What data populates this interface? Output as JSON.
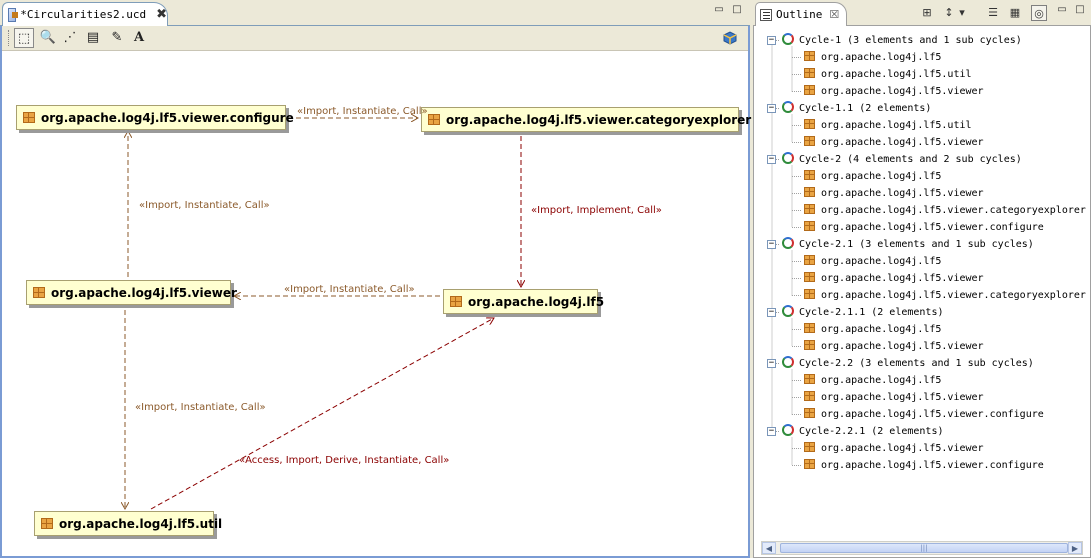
{
  "editor": {
    "tab_title": "*Circularities2.ucd",
    "tab_close": "✖",
    "minimize": "▭",
    "maximize": "□",
    "toolbar": {
      "select": "⬚",
      "zoom": "🔍",
      "connection": "⋰",
      "note": "▤",
      "pin": "✎",
      "text": "A"
    },
    "nodes": {
      "configure": "org.apache.log4j.lf5.viewer.configure",
      "categoryexplorer": "org.apache.log4j.lf5.viewer.categoryexplorer",
      "viewer": "org.apache.log4j.lf5.viewer",
      "lf5": "org.apache.log4j.lf5",
      "util": "org.apache.log4j.lf5.util"
    },
    "edges": {
      "configure_to_categoryexplorer": "«Import, Instantiate, Call»",
      "viewer_to_configure": "«Import, Instantiate, Call»",
      "categoryexplorer_to_lf5": "«Import, Implement, Call»",
      "lf5_to_viewer": "«Import, Instantiate, Call»",
      "viewer_to_util": "«Import, Instantiate, Call»",
      "util_to_lf5": "«Access, Import, Derive, Instantiate, Call»"
    },
    "colors": {
      "edge_brown": "#8b5a2b",
      "edge_red": "#8b0000"
    }
  },
  "outline": {
    "tab_title": "Outline",
    "tab_close": "☒",
    "minimize": "▭",
    "maximize": "□",
    "toolbar": {
      "hierarchy": "⊞",
      "sort": "↕",
      "menu": "▾",
      "collapse": "☰",
      "layout": "▦",
      "cycles": "◎"
    },
    "collapse_glyph": "−",
    "cycles": [
      {
        "label": "Cycle-1   (3 elements and 1 sub cycles)",
        "items": [
          "org.apache.log4j.lf5",
          "org.apache.log4j.lf5.util",
          "org.apache.log4j.lf5.viewer"
        ]
      },
      {
        "label": "Cycle-1.1  (2 elements)",
        "items": [
          "org.apache.log4j.lf5.util",
          "org.apache.log4j.lf5.viewer"
        ]
      },
      {
        "label": "Cycle-2   (4 elements and 2 sub cycles)",
        "items": [
          "org.apache.log4j.lf5",
          "org.apache.log4j.lf5.viewer",
          "org.apache.log4j.lf5.viewer.categoryexplorer",
          "org.apache.log4j.lf5.viewer.configure"
        ]
      },
      {
        "label": "Cycle-2.1  (3 elements and 1 sub cycles)",
        "items": [
          "org.apache.log4j.lf5",
          "org.apache.log4j.lf5.viewer",
          "org.apache.log4j.lf5.viewer.categoryexplorer"
        ]
      },
      {
        "label": "Cycle-2.1.1  (2 elements)",
        "items": [
          "org.apache.log4j.lf5",
          "org.apache.log4j.lf5.viewer"
        ]
      },
      {
        "label": "Cycle-2.2  (3 elements and 1 sub cycles)",
        "items": [
          "org.apache.log4j.lf5",
          "org.apache.log4j.lf5.viewer",
          "org.apache.log4j.lf5.viewer.configure"
        ]
      },
      {
        "label": "Cycle-2.2.1  (2 elements)",
        "items": [
          "org.apache.log4j.lf5.viewer",
          "org.apache.log4j.lf5.viewer.configure"
        ]
      }
    ],
    "scroll_left": "◀",
    "scroll_right": "▶",
    "scroll_grip": "|||"
  }
}
